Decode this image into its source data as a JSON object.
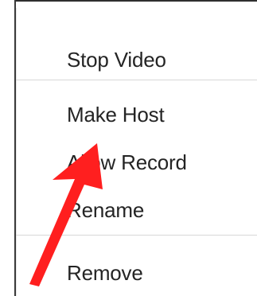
{
  "menu": {
    "items": [
      {
        "label": "Stop Video"
      },
      {
        "label": "Make Host"
      },
      {
        "label": "Allow Record"
      },
      {
        "label": "Rename"
      },
      {
        "label": "Remove"
      }
    ]
  },
  "colors": {
    "text": "#242424",
    "separator": "#d7d7d7",
    "annotation_arrow": "#ff1f1f"
  },
  "icons": {
    "annotation": "red-arrow-icon"
  }
}
